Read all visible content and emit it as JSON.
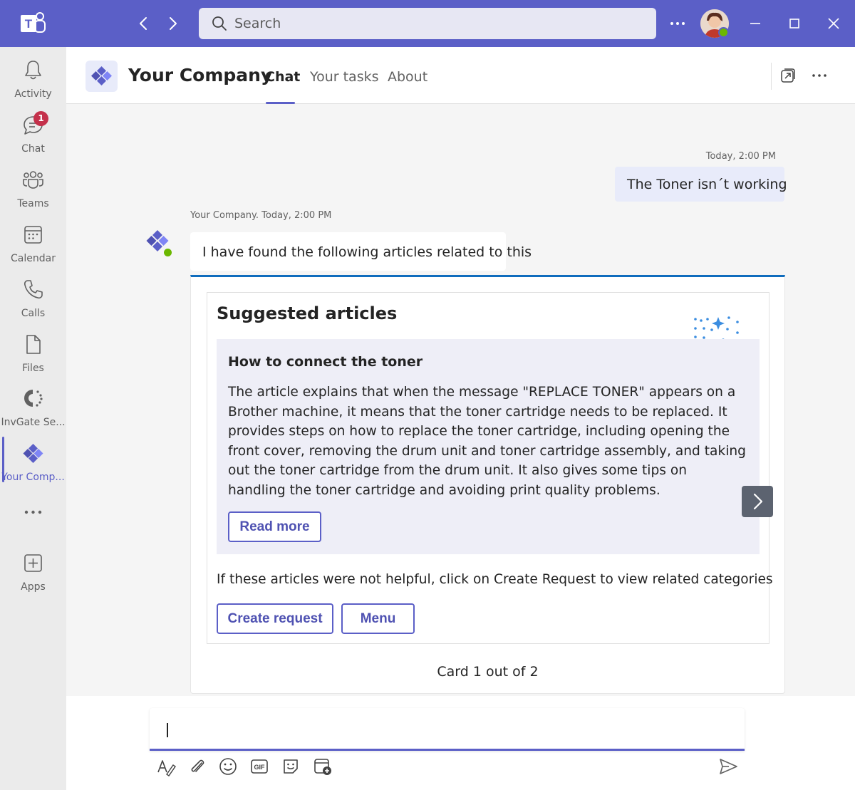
{
  "titlebar": {
    "search_placeholder": "Search"
  },
  "rail": {
    "items": [
      {
        "label": "Activity",
        "icon": "bell-icon"
      },
      {
        "label": "Chat",
        "icon": "chat-icon",
        "badge": "1"
      },
      {
        "label": "Teams",
        "icon": "teams-icon"
      },
      {
        "label": "Calendar",
        "icon": "calendar-icon"
      },
      {
        "label": "Calls",
        "icon": "phone-icon"
      },
      {
        "label": "Files",
        "icon": "file-icon"
      },
      {
        "label": "InvGate Se...",
        "icon": "invgate-icon"
      },
      {
        "label": "Your Comp...",
        "icon": "your-company-icon",
        "active": true
      },
      {
        "label": "Apps",
        "icon": "add-app-icon"
      }
    ]
  },
  "header": {
    "app_name": "Your Company",
    "tabs": [
      {
        "label": "Chat",
        "active": true
      },
      {
        "label": "Your tasks"
      },
      {
        "label": "About"
      }
    ]
  },
  "messages": {
    "outgoing": {
      "time": "Today, 2:00 PM",
      "text": "The Toner isn´t working"
    },
    "incoming": {
      "meta": "Your Company. Today, 2:00 PM",
      "text": "I have found the following articles related to this"
    }
  },
  "card": {
    "title": "Suggested articles",
    "article": {
      "title": "How to connect the toner",
      "body": "The article explains that when the message \"REPLACE TONER\" appears on a Brother machine, it means that the toner cartridge needs to be replaced. It provides steps on how to replace the toner cartridge, including opening the front cover, removing the drum unit and toner cartridge assembly, and taking out the toner cartridge from the drum unit. It also gives some tips on handling the toner cartridge and avoiding print quality problems.",
      "read_more": "Read more"
    },
    "note": "If these articles were not helpful, click on Create Request to view related categories",
    "create_request": "Create request",
    "menu": "Menu",
    "counter": "Card 1 out of 2"
  },
  "colors": {
    "brand": "#5b5fc7",
    "card_accent": "#0f6cbd",
    "status_available": "#6bb700",
    "badge": "#c4314b"
  }
}
